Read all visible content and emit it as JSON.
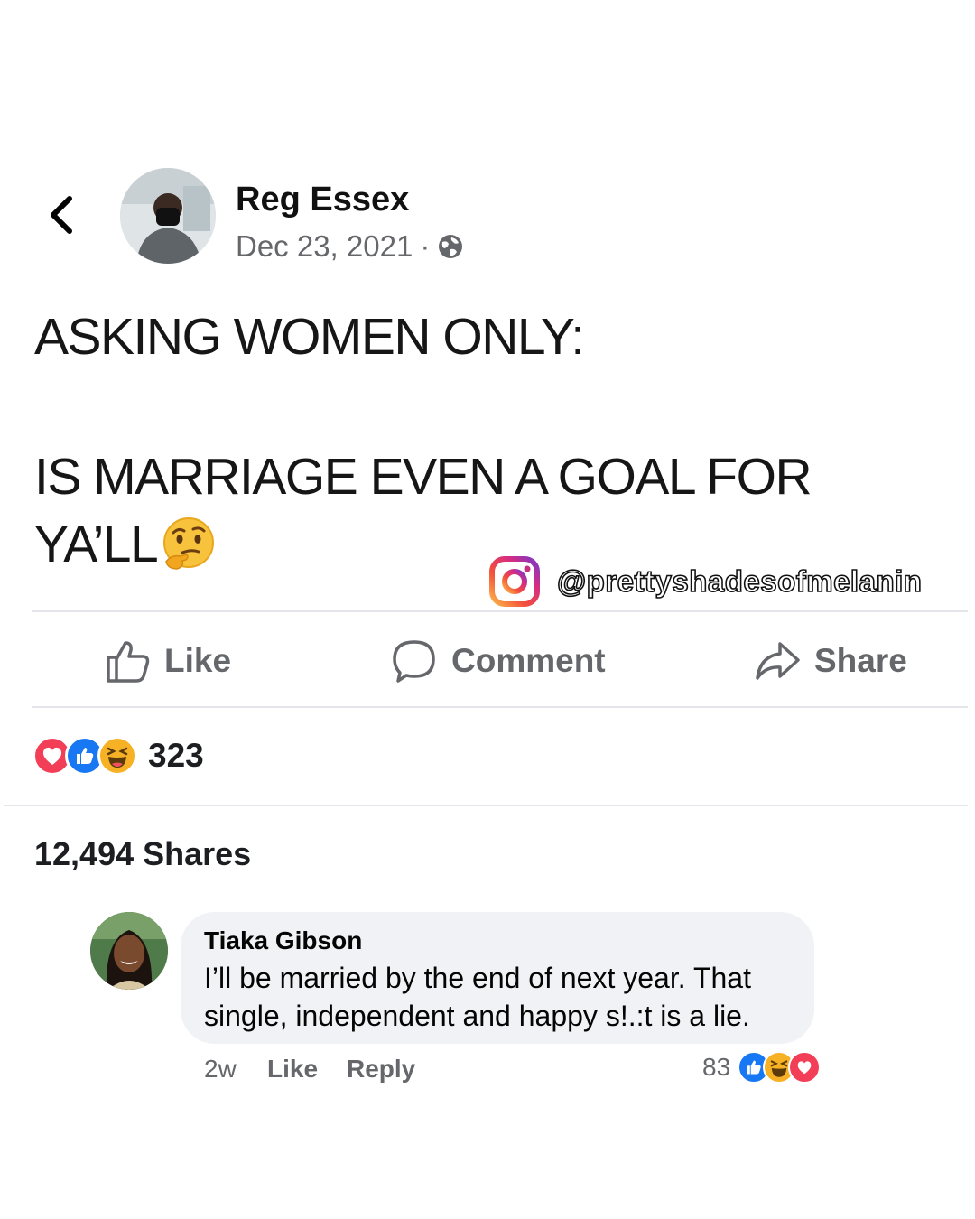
{
  "post": {
    "author": "Reg Essex",
    "date": "Dec 23, 2021",
    "separator": "·",
    "lines": [
      "ASKING WOMEN ONLY:",
      "IS MARRIAGE EVEN A GOAL FOR",
      "YA’LL"
    ]
  },
  "watermark": {
    "handle": "@prettyshadesofmelanin"
  },
  "actions": {
    "like": "Like",
    "comment": "Comment",
    "share": "Share"
  },
  "stats": {
    "reaction_count": "323",
    "shares": "12,494 Shares"
  },
  "comment": {
    "author": "Tiaka Gibson",
    "text": "I’ll be married by the end of next year. That single, independent and happy s!.:t is a lie.",
    "age": "2w",
    "like": "Like",
    "reply": "Reply",
    "reaction_count": "83"
  },
  "colors": {
    "like_blue": "#1877f2",
    "love_red": "#f33e58",
    "haha_yellow": "#f7b125",
    "secondary_text": "#65676b",
    "bubble_bg": "#f0f2f5"
  },
  "icons": [
    "back-chevron-icon",
    "globe-icon",
    "thinking-face-emoji",
    "instagram-icon",
    "like-icon",
    "comment-icon",
    "share-icon",
    "love-reaction-icon",
    "like-reaction-icon",
    "haha-reaction-icon"
  ]
}
